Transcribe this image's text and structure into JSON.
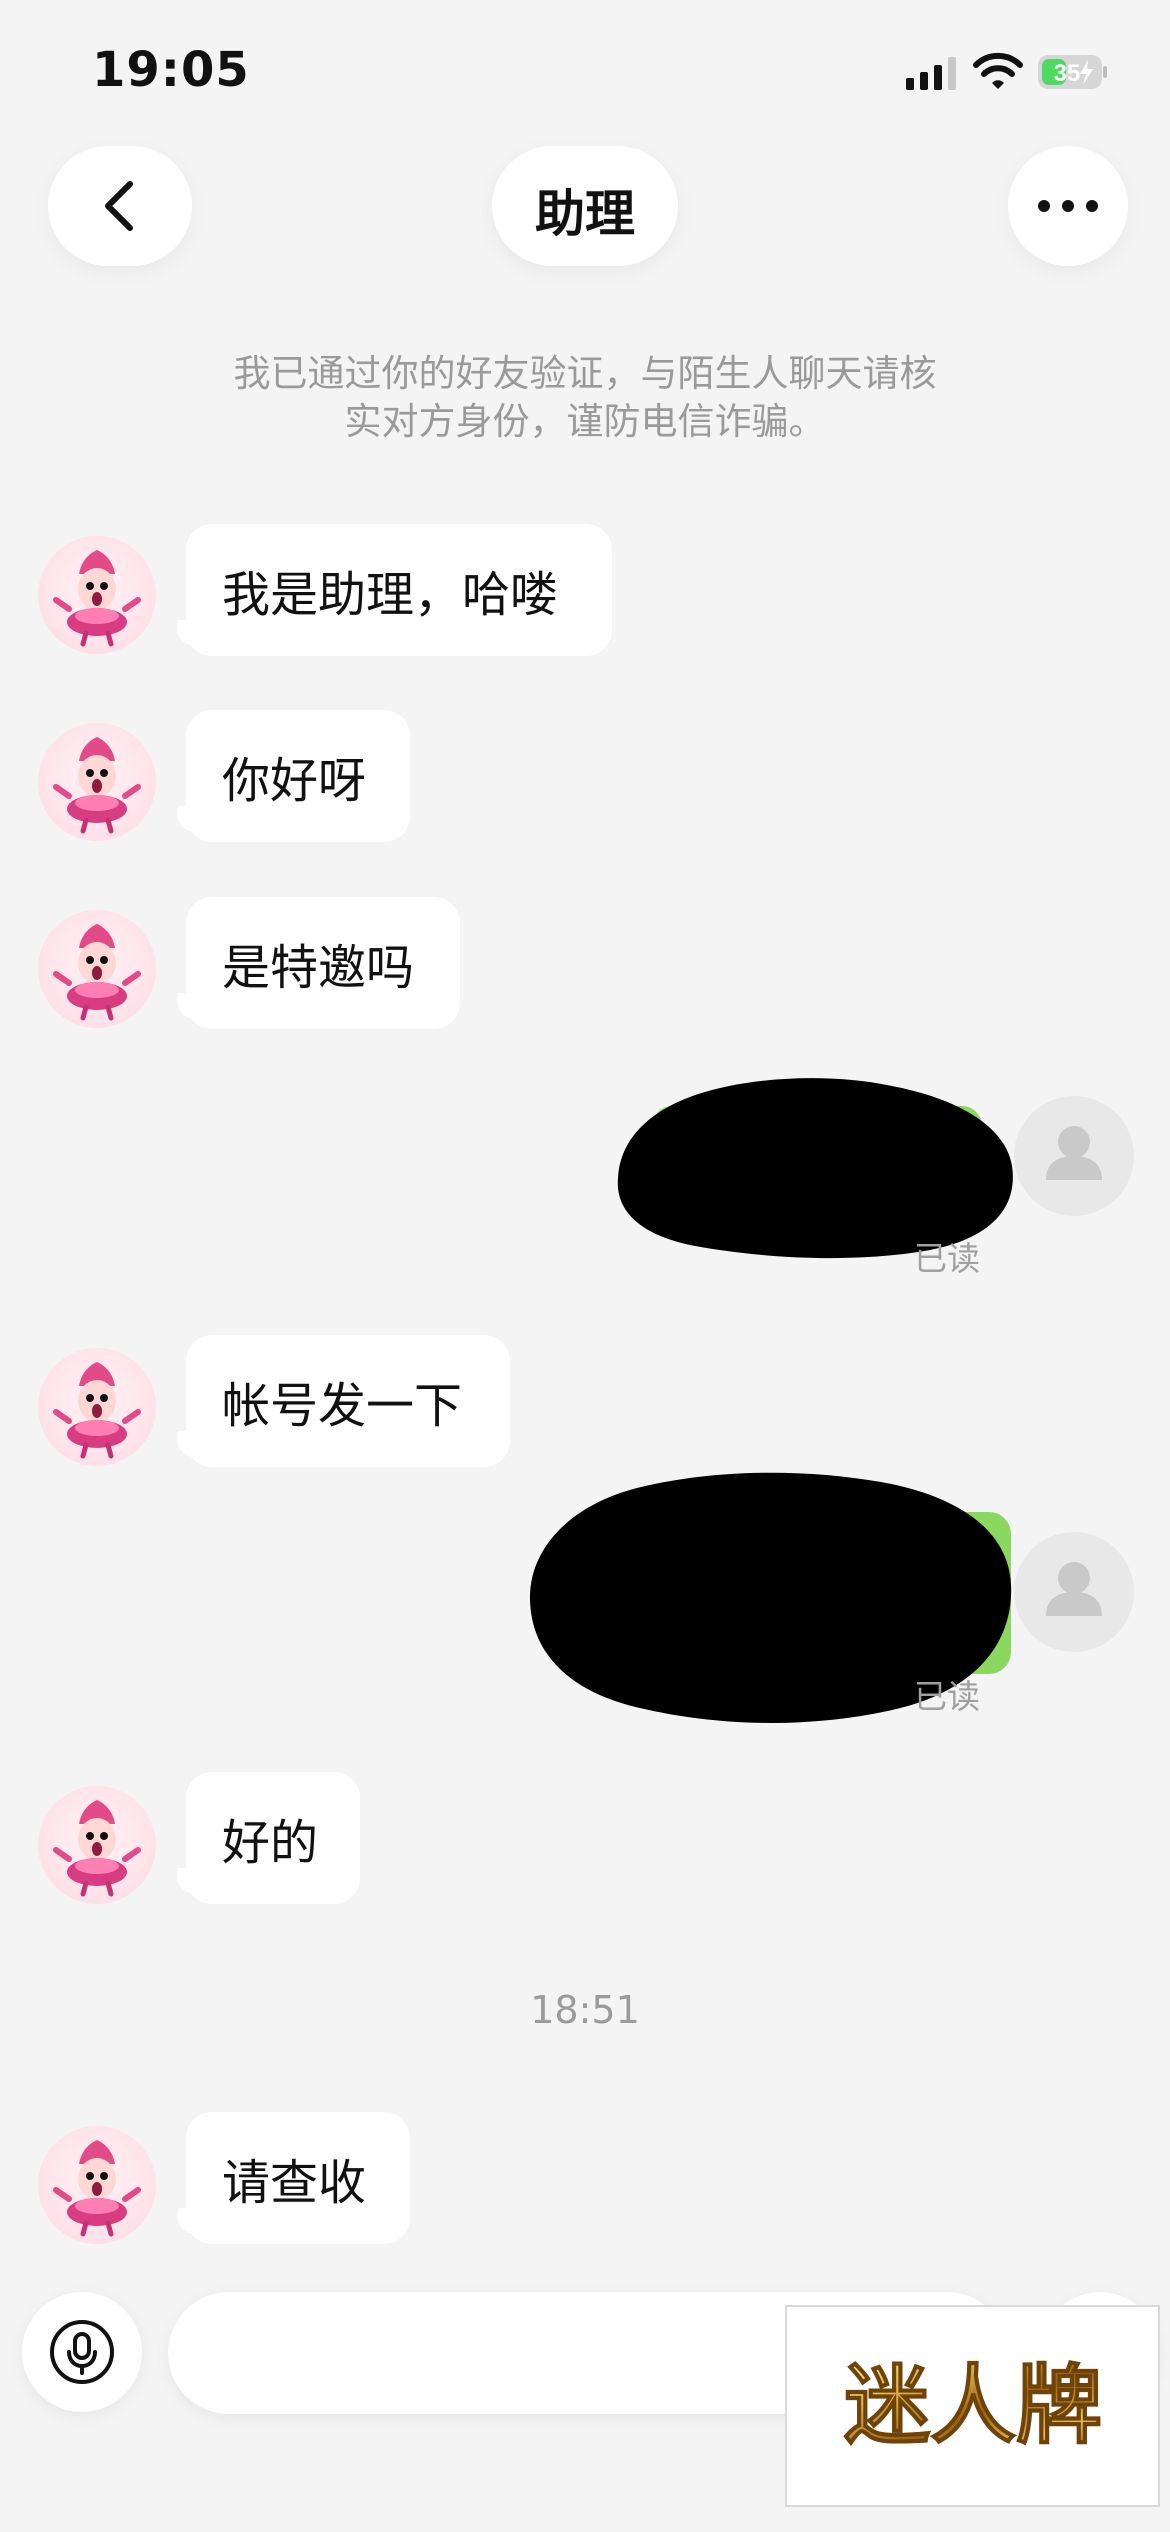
{
  "status_bar": {
    "time": "19:05",
    "battery": "35"
  },
  "header": {
    "title": "助理"
  },
  "system_notice": {
    "lines": [
      "我已通过你的好友验证，与陌生人聊天请核",
      "实对方身份，谨防电信诈骗。"
    ]
  },
  "messages": {
    "m1": "我是助理，哈喽",
    "m2": "你好呀",
    "m3": "是特邀吗",
    "m4": "帐号发一下",
    "m5": "好的",
    "m6": "请查收"
  },
  "read_receipts": {
    "r1": "已读",
    "r2": "已读"
  },
  "timestamp": "18:51",
  "input": {
    "placeholder": ""
  },
  "watermark": "迷人牌",
  "colors": {
    "background": "#f4f4f4",
    "bubble_in": "#ffffff",
    "text": "#111111",
    "muted_text": "#9a9a9a",
    "avatar_bg": "#ffe0e8",
    "pink_character": "#e24b88",
    "battery_green": "#4cd964",
    "watermark_gold": "#b8860b"
  },
  "icons": {
    "back": "chevron-left-icon",
    "more": "more-horizontal-icon",
    "signal": "signal-bars-icon",
    "wifi": "wifi-icon",
    "battery": "battery-charging-icon",
    "mic": "microphone-icon",
    "self_avatar": "default-user-icon",
    "other_avatar": "cartoon-avatar-icon"
  }
}
